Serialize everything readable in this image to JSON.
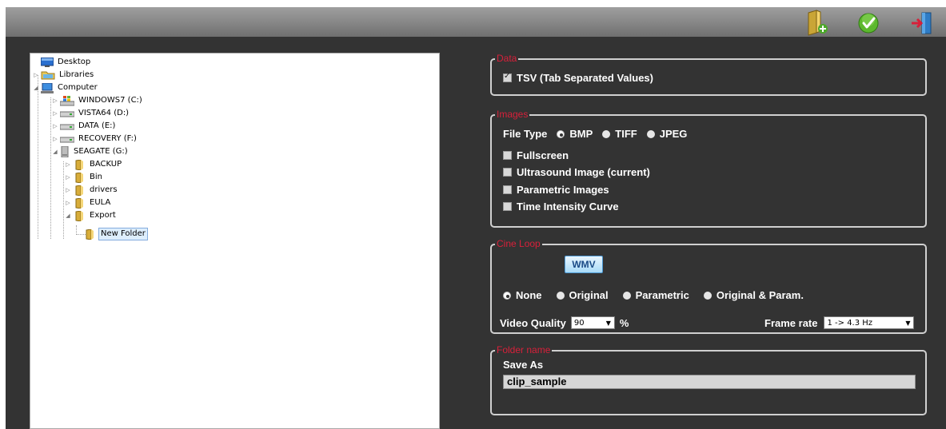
{
  "tree": {
    "items": [
      {
        "label": "Desktop",
        "level": 0,
        "icon": "desktop-icon"
      },
      {
        "label": "Libraries",
        "level": 1,
        "icon": "libraries-icon"
      },
      {
        "label": "Computer",
        "level": 1,
        "icon": "computer-icon"
      },
      {
        "label": "WINDOWS7 (C:)",
        "level": 2,
        "icon": "system-drive-icon"
      },
      {
        "label": "VISTA64 (D:)",
        "level": 2,
        "icon": "drive-icon"
      },
      {
        "label": "DATA (E:)",
        "level": 2,
        "icon": "drive-icon"
      },
      {
        "label": "RECOVERY (F:)",
        "level": 2,
        "icon": "drive-icon"
      },
      {
        "label": "SEAGATE (G:)",
        "level": 2,
        "icon": "usb-drive-icon"
      },
      {
        "label": "BACKUP",
        "level": 3,
        "icon": "folder-icon"
      },
      {
        "label": "Bin",
        "level": 3,
        "icon": "folder-icon"
      },
      {
        "label": "drivers",
        "level": 3,
        "icon": "folder-icon"
      },
      {
        "label": "EULA",
        "level": 3,
        "icon": "folder-icon"
      },
      {
        "label": "Export",
        "level": 3,
        "icon": "folder-icon"
      },
      {
        "label": "New Folder",
        "level": 4,
        "icon": "folder-icon",
        "selected": true
      }
    ]
  },
  "toolbar": {
    "buttons": [
      {
        "icon": "new-folder-icon"
      },
      {
        "icon": "checkmark-icon"
      },
      {
        "icon": "exit-icon"
      }
    ]
  },
  "data_group": {
    "legend": "Data",
    "tsv_label": "TSV (Tab Separated Values)",
    "tsv_checked": true
  },
  "images_group": {
    "legend": "Images",
    "file_type_label": "File Type",
    "file_types": [
      "BMP",
      "TIFF",
      "JPEG"
    ],
    "selected_file_type": "BMP",
    "options": [
      "Fullscreen",
      "Ultrasound Image (current)",
      "Parametric Images",
      "Time Intensity Curve"
    ]
  },
  "cine_group": {
    "legend": "Cine Loop",
    "format_button": "WMV",
    "modes": [
      "None",
      "Original",
      "Parametric",
      "Original & Param."
    ],
    "selected_mode": "None",
    "video_quality_label": "Video Quality",
    "video_quality_value": "90",
    "percent_unit": "%",
    "frame_rate_label": "Frame rate",
    "frame_rate_value": "1 -> 4.3 Hz"
  },
  "folder_group": {
    "legend": "Folder name",
    "save_as_label": "Save As",
    "save_as_value": "clip_sample"
  },
  "colors": {
    "panel_bg": "#333333",
    "legend_red": "#d8203a",
    "border": "#d0d0d0",
    "selection": "#ddeefd"
  }
}
